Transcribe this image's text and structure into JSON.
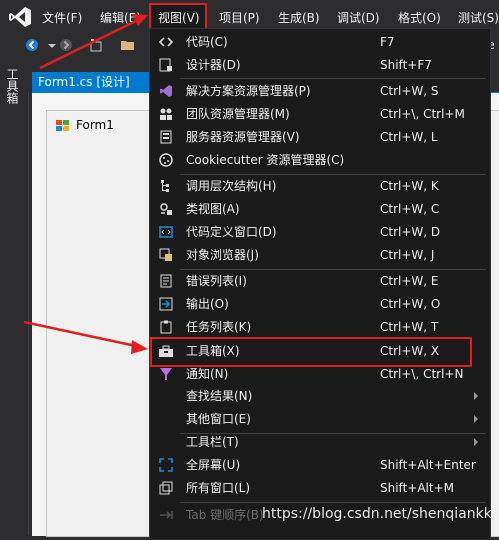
{
  "menubar": {
    "items": [
      {
        "label": "文件(F)"
      },
      {
        "label": "编辑(E)"
      },
      {
        "label": "视图(V)"
      },
      {
        "label": "项目(P)"
      },
      {
        "label": "生成(B)"
      },
      {
        "label": "调试(D)"
      },
      {
        "label": "格式(O)"
      },
      {
        "label": "测试(S)"
      }
    ]
  },
  "toolbar": {
    "cut_label": "le"
  },
  "toolbox_strip": {
    "label": "工具箱"
  },
  "document": {
    "tab_label": "Form1.cs [设计]",
    "form_title": "Form1"
  },
  "view_menu": {
    "items": [
      {
        "label": "代码(C)",
        "shortcut": "F7",
        "icon": "code-icon"
      },
      {
        "label": "设计器(D)",
        "shortcut": "Shift+F7",
        "icon": "designer-icon"
      },
      {
        "label": "解决方案资源管理器(P)",
        "shortcut": "Ctrl+W, S",
        "icon": "solution-explorer-icon"
      },
      {
        "label": "团队资源管理器(M)",
        "shortcut": "Ctrl+\\, Ctrl+M",
        "icon": "team-explorer-icon"
      },
      {
        "label": "服务器资源管理器(V)",
        "shortcut": "Ctrl+W, L",
        "icon": "server-explorer-icon"
      },
      {
        "label": "Cookiecutter 资源管理器(C)",
        "shortcut": "",
        "icon": "cookiecutter-icon"
      },
      {
        "label": "调用层次结构(H)",
        "shortcut": "Ctrl+W, K",
        "icon": "call-hierarchy-icon"
      },
      {
        "label": "类视图(A)",
        "shortcut": "Ctrl+W, C",
        "icon": "class-view-icon"
      },
      {
        "label": "代码定义窗口(D)",
        "shortcut": "Ctrl+W, D",
        "icon": "code-definition-icon"
      },
      {
        "label": "对象浏览器(J)",
        "shortcut": "Ctrl+W, J",
        "icon": "object-browser-icon"
      },
      {
        "label": "错误列表(I)",
        "shortcut": "Ctrl+W, E",
        "icon": "error-list-icon"
      },
      {
        "label": "输出(O)",
        "shortcut": "Ctrl+W, O",
        "icon": "output-icon"
      },
      {
        "label": "任务列表(K)",
        "shortcut": "Ctrl+W, T",
        "icon": "task-list-icon"
      },
      {
        "label": "工具箱(X)",
        "shortcut": "Ctrl+W, X",
        "icon": "toolbox-icon"
      },
      {
        "label": "通知(N)",
        "shortcut": "Ctrl+\\, Ctrl+N",
        "icon": "notification-icon"
      },
      {
        "label": "查找结果(N)",
        "shortcut": "",
        "icon": ""
      },
      {
        "label": "其他窗口(E)",
        "shortcut": "",
        "icon": ""
      },
      {
        "label": "工具栏(T)",
        "shortcut": "",
        "icon": ""
      },
      {
        "label": "全屏幕(U)",
        "shortcut": "Shift+Alt+Enter",
        "icon": "fullscreen-icon"
      },
      {
        "label": "所有窗口(L)",
        "shortcut": "Shift+Alt+M",
        "icon": "all-windows-icon"
      },
      {
        "label": "Tab 键顺序(B)",
        "shortcut": "",
        "icon": "tab-order-icon"
      }
    ]
  },
  "watermark": "https://blog.csdn.net/shenqiankk",
  "colors": {
    "accent": "#007acc",
    "highlight_border": "#e02020",
    "menu_bg": "#1b1b1c",
    "chrome_bg": "#2d2d30"
  }
}
